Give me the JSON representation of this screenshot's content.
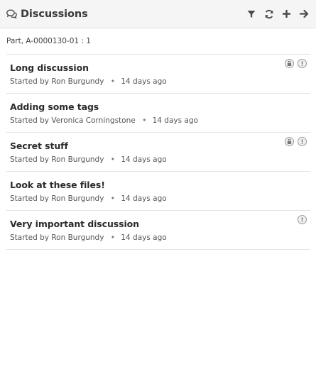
{
  "header": {
    "title": "Discussions",
    "title_icon": "comments-icon",
    "tools": [
      {
        "name": "filter-icon"
      },
      {
        "name": "refresh-icon"
      },
      {
        "name": "plus-icon"
      },
      {
        "name": "arrow-right-icon"
      }
    ]
  },
  "context": {
    "label": "Part, A-0000130-01 : 1"
  },
  "meta": {
    "started_by_prefix": "Started by",
    "separator": "•"
  },
  "discussions": [
    {
      "title": "Long discussion",
      "author": "Ron Burgundy",
      "age": "14 days ago",
      "locked": true,
      "important": true
    },
    {
      "title": "Adding some tags",
      "author": "Veronica Corningstone",
      "age": "14 days ago",
      "locked": false,
      "important": false
    },
    {
      "title": "Secret stuff",
      "author": "Ron Burgundy",
      "age": "14 days ago",
      "locked": true,
      "important": true
    },
    {
      "title": "Look at these files!",
      "author": "Ron Burgundy",
      "age": "14 days ago",
      "locked": false,
      "important": false
    },
    {
      "title": "Very important discussion",
      "author": "Ron Burgundy",
      "age": "14 days ago",
      "locked": false,
      "important": true
    }
  ]
}
